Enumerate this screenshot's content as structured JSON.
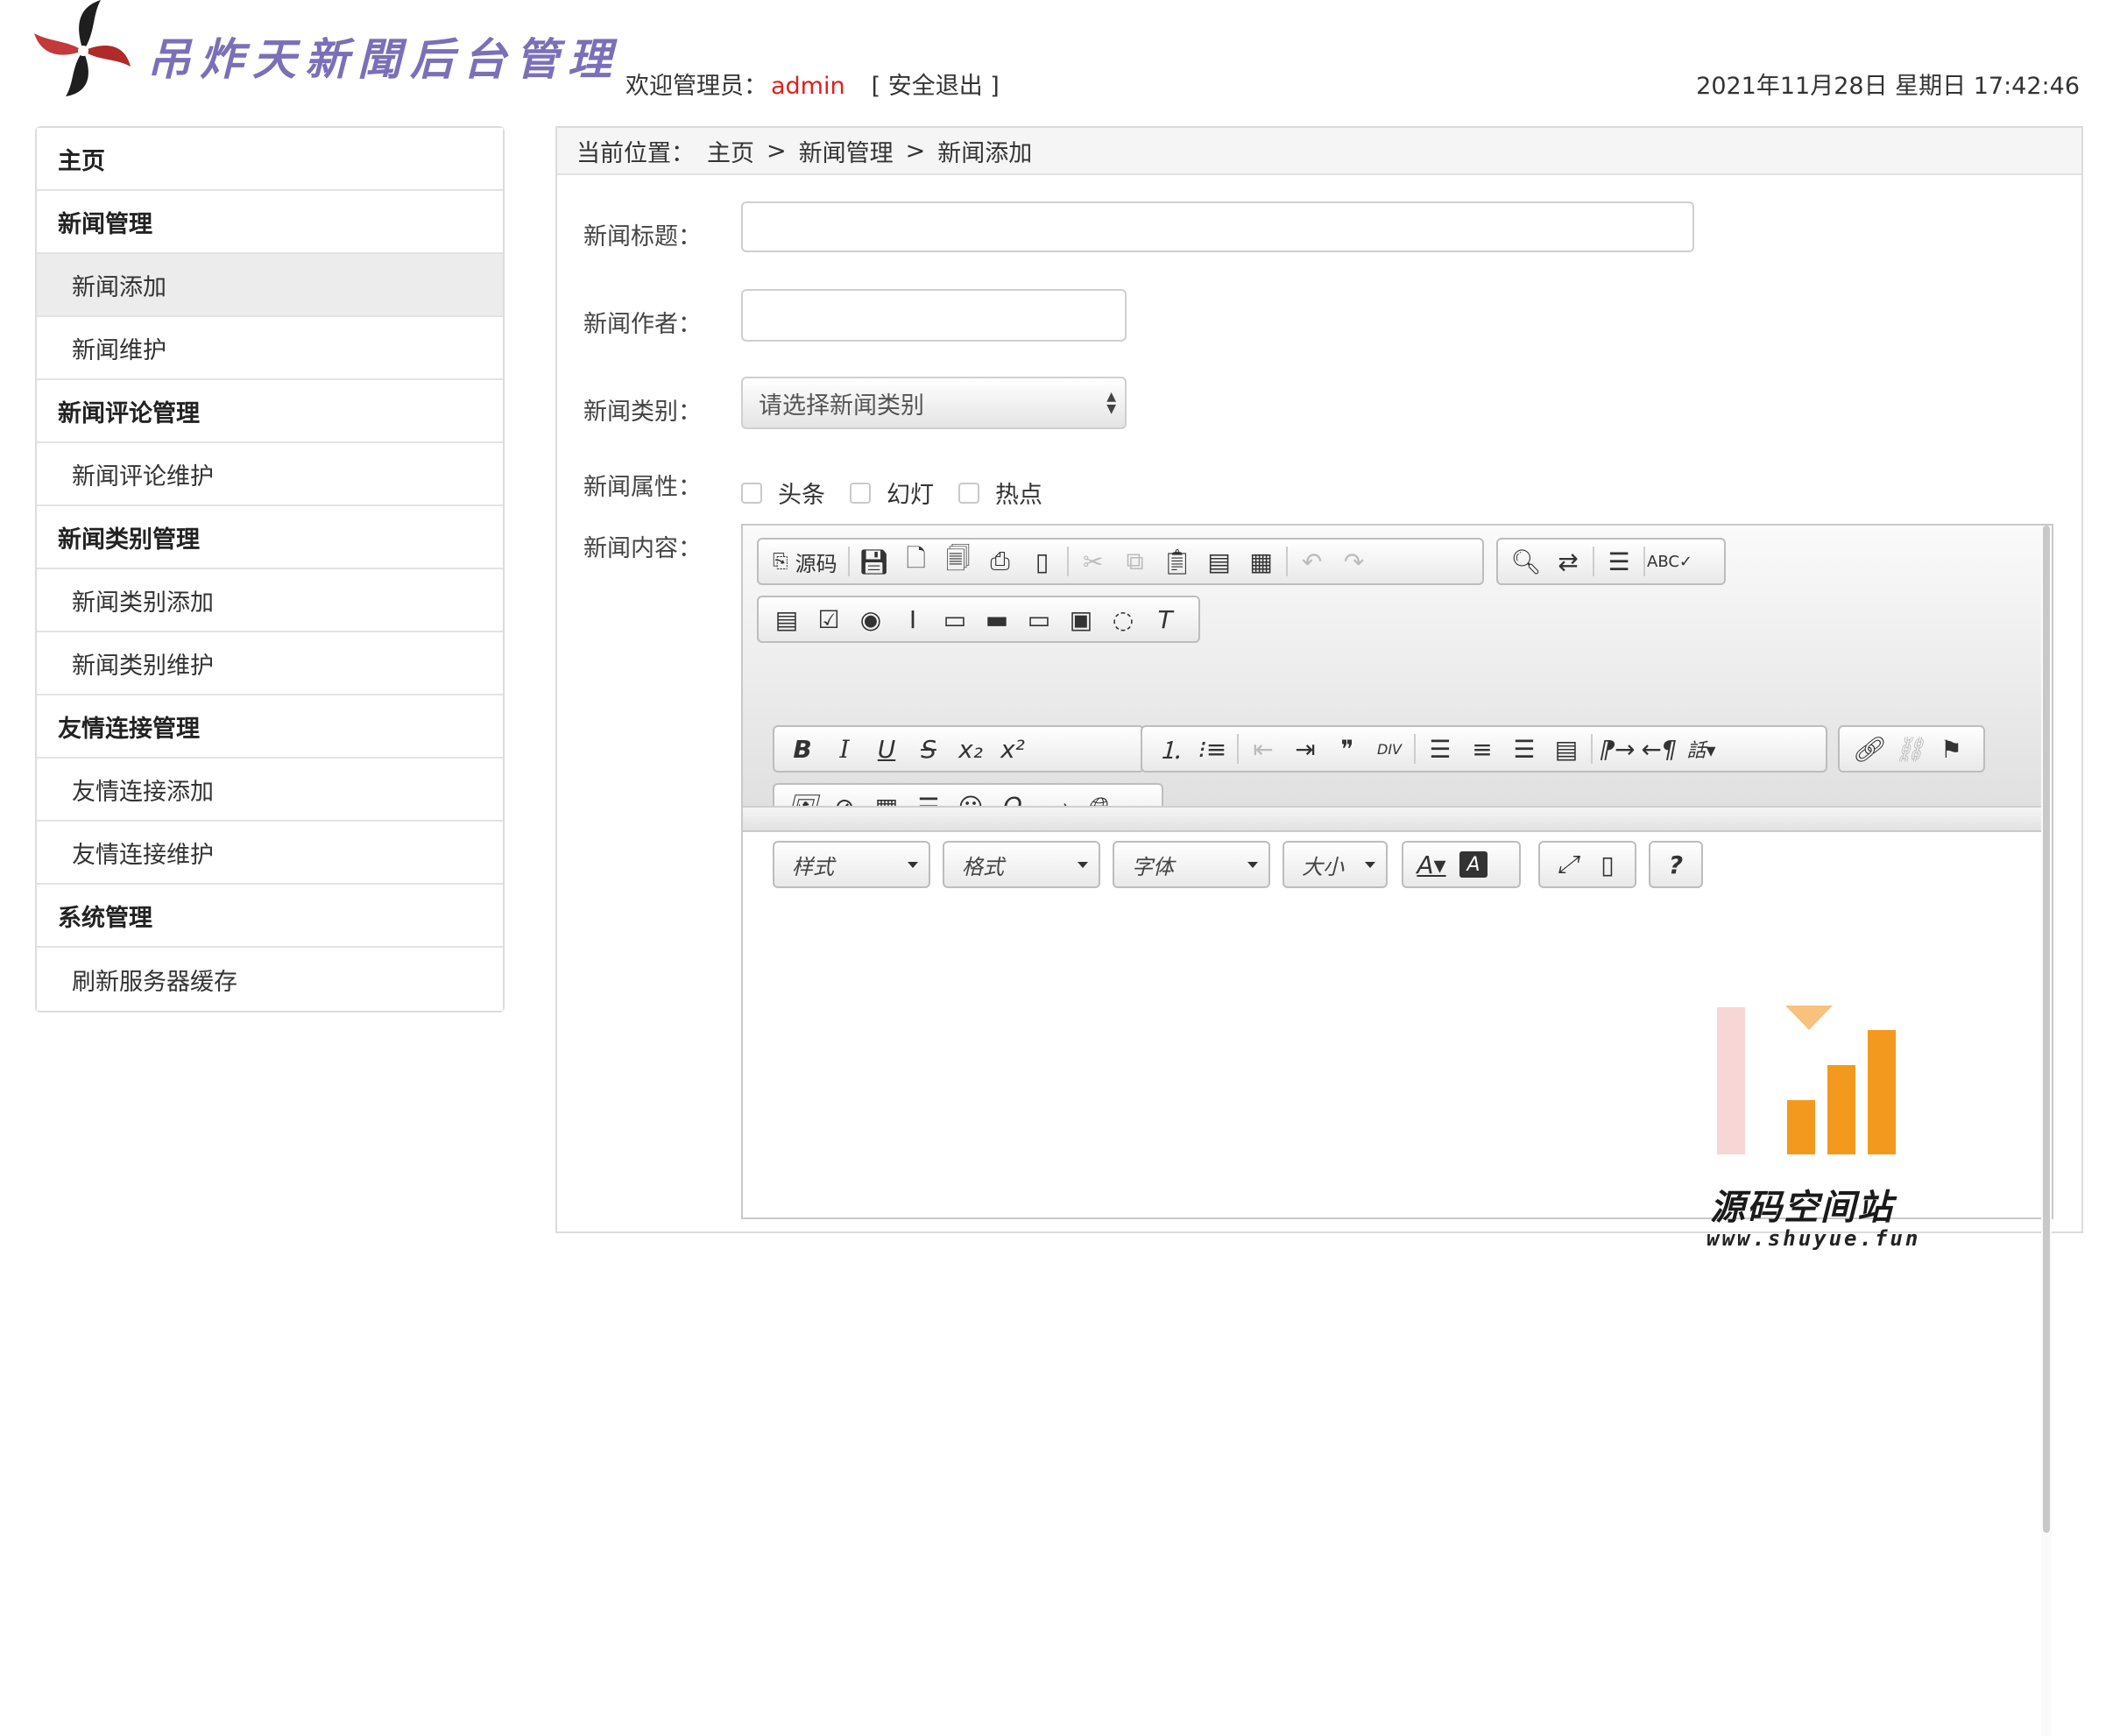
{
  "header": {
    "brand_title": "吊炸天新聞后台管理",
    "welcome_prefix": "欢迎管理员：",
    "admin_name": "admin",
    "logout_label": "[ 安全退出 ]",
    "datetime": "2021年11月28日 星期日 17:42:46"
  },
  "sidebar": {
    "items": [
      {
        "label": "主页"
      },
      {
        "label": "新闻管理"
      },
      {
        "label": "新闻添加"
      },
      {
        "label": "新闻维护"
      },
      {
        "label": "新闻评论管理"
      },
      {
        "label": "新闻评论维护"
      },
      {
        "label": "新闻类别管理"
      },
      {
        "label": "新闻类别添加"
      },
      {
        "label": "新闻类别维护"
      },
      {
        "label": "友情连接管理"
      },
      {
        "label": "友情连接添加"
      },
      {
        "label": "友情连接维护"
      },
      {
        "label": "系统管理"
      },
      {
        "label": "刷新服务器缓存"
      }
    ]
  },
  "breadcrumb": {
    "prefix": "当前位置：",
    "items": [
      "主页",
      "新闻管理",
      "新闻添加"
    ],
    "separator": ">"
  },
  "form": {
    "title_label": "新闻标题：",
    "title_value": "",
    "author_label": "新闻作者：",
    "author_value": "",
    "category_label": "新闻类别：",
    "category_selected": "请选择新闻类别",
    "attr_label": "新闻属性：",
    "attrs": [
      "头条",
      "幻灯",
      "热点"
    ],
    "content_label": "新闻内容："
  },
  "editor": {
    "source_label": "源码",
    "combos": [
      "样式",
      "格式",
      "字体",
      "大小"
    ]
  },
  "watermark": {
    "text": "源码空间站",
    "url": "www.shuyue.fun"
  },
  "colors": {
    "accent_red": "#e0201a",
    "brand_purple": "#7b6fb8",
    "watermark_orange": "#f39a1e"
  }
}
